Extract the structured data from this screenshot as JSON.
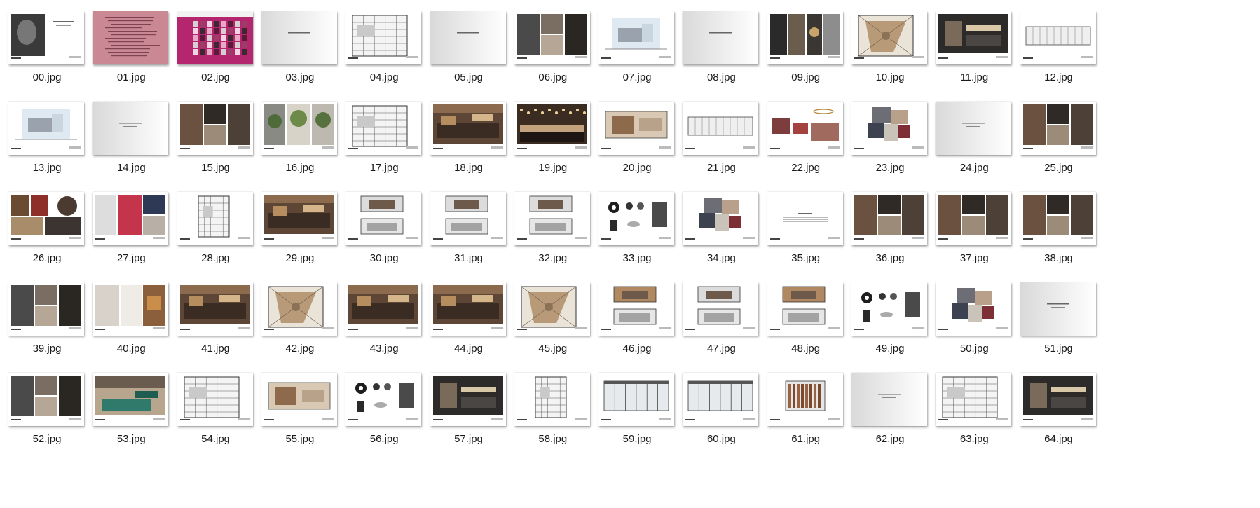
{
  "files": [
    {
      "name": "00.jpg",
      "kind": "cover-portrait"
    },
    {
      "name": "01.jpg",
      "kind": "pink-text"
    },
    {
      "name": "02.jpg",
      "kind": "magenta-grid"
    },
    {
      "name": "03.jpg",
      "kind": "title"
    },
    {
      "name": "04.jpg",
      "kind": "plan"
    },
    {
      "name": "05.jpg",
      "kind": "title"
    },
    {
      "name": "06.jpg",
      "kind": "photo-collage"
    },
    {
      "name": "07.jpg",
      "kind": "sketch"
    },
    {
      "name": "08.jpg",
      "kind": "title"
    },
    {
      "name": "09.jpg",
      "kind": "dark-moodboard"
    },
    {
      "name": "10.jpg",
      "kind": "plan-color"
    },
    {
      "name": "11.jpg",
      "kind": "render-dark"
    },
    {
      "name": "12.jpg",
      "kind": "elevation"
    },
    {
      "name": "13.jpg",
      "kind": "sketch"
    },
    {
      "name": "14.jpg",
      "kind": "title"
    },
    {
      "name": "15.jpg",
      "kind": "photo-collage"
    },
    {
      "name": "16.jpg",
      "kind": "plants-collage"
    },
    {
      "name": "17.jpg",
      "kind": "plan"
    },
    {
      "name": "18.jpg",
      "kind": "render-warm"
    },
    {
      "name": "19.jpg",
      "kind": "render-bar"
    },
    {
      "name": "20.jpg",
      "kind": "elevation-color"
    },
    {
      "name": "21.jpg",
      "kind": "elevation"
    },
    {
      "name": "22.jpg",
      "kind": "furniture"
    },
    {
      "name": "23.jpg",
      "kind": "material-board"
    },
    {
      "name": "24.jpg",
      "kind": "title"
    },
    {
      "name": "25.jpg",
      "kind": "photo-collage"
    },
    {
      "name": "26.jpg",
      "kind": "food-collage"
    },
    {
      "name": "27.jpg",
      "kind": "photo-collage-red"
    },
    {
      "name": "28.jpg",
      "kind": "plan-tall"
    },
    {
      "name": "29.jpg",
      "kind": "render-warm"
    },
    {
      "name": "30.jpg",
      "kind": "elevation-two"
    },
    {
      "name": "31.jpg",
      "kind": "elevation-two"
    },
    {
      "name": "32.jpg",
      "kind": "elevation-two"
    },
    {
      "name": "33.jpg",
      "kind": "fixtures"
    },
    {
      "name": "34.jpg",
      "kind": "material-board"
    },
    {
      "name": "35.jpg",
      "kind": "title-text"
    },
    {
      "name": "36.jpg",
      "kind": "photo-collage"
    },
    {
      "name": "37.jpg",
      "kind": "photo-collage"
    },
    {
      "name": "38.jpg",
      "kind": "photo-collage"
    },
    {
      "name": "39.jpg",
      "kind": "photo-collage"
    },
    {
      "name": "40.jpg",
      "kind": "photo-collage-light"
    },
    {
      "name": "41.jpg",
      "kind": "render-warm"
    },
    {
      "name": "42.jpg",
      "kind": "plan-color"
    },
    {
      "name": "43.jpg",
      "kind": "render-warm"
    },
    {
      "name": "44.jpg",
      "kind": "render-warm"
    },
    {
      "name": "45.jpg",
      "kind": "plan-color"
    },
    {
      "name": "46.jpg",
      "kind": "elevation-two-color"
    },
    {
      "name": "47.jpg",
      "kind": "elevation-two"
    },
    {
      "name": "48.jpg",
      "kind": "elevation-two-color"
    },
    {
      "name": "49.jpg",
      "kind": "fixtures"
    },
    {
      "name": "50.jpg",
      "kind": "material-board"
    },
    {
      "name": "51.jpg",
      "kind": "title"
    },
    {
      "name": "52.jpg",
      "kind": "photo-collage"
    },
    {
      "name": "53.jpg",
      "kind": "render-green"
    },
    {
      "name": "54.jpg",
      "kind": "plan"
    },
    {
      "name": "55.jpg",
      "kind": "elevation-color"
    },
    {
      "name": "56.jpg",
      "kind": "fixtures"
    },
    {
      "name": "57.jpg",
      "kind": "render-dark"
    },
    {
      "name": "58.jpg",
      "kind": "plan-tall"
    },
    {
      "name": "59.jpg",
      "kind": "elevation-glass"
    },
    {
      "name": "60.jpg",
      "kind": "elevation-glass"
    },
    {
      "name": "61.jpg",
      "kind": "elevation-wood"
    },
    {
      "name": "62.jpg",
      "kind": "title"
    },
    {
      "name": "63.jpg",
      "kind": "plan"
    },
    {
      "name": "64.jpg",
      "kind": "render-dark"
    }
  ],
  "colors": {
    "page_bg": "#ffffff",
    "label": "#1a1a1a",
    "pink": "#c77a86",
    "magenta": "#b4266e",
    "wood": "#8a5a3a",
    "dark": "#2e2a26"
  }
}
